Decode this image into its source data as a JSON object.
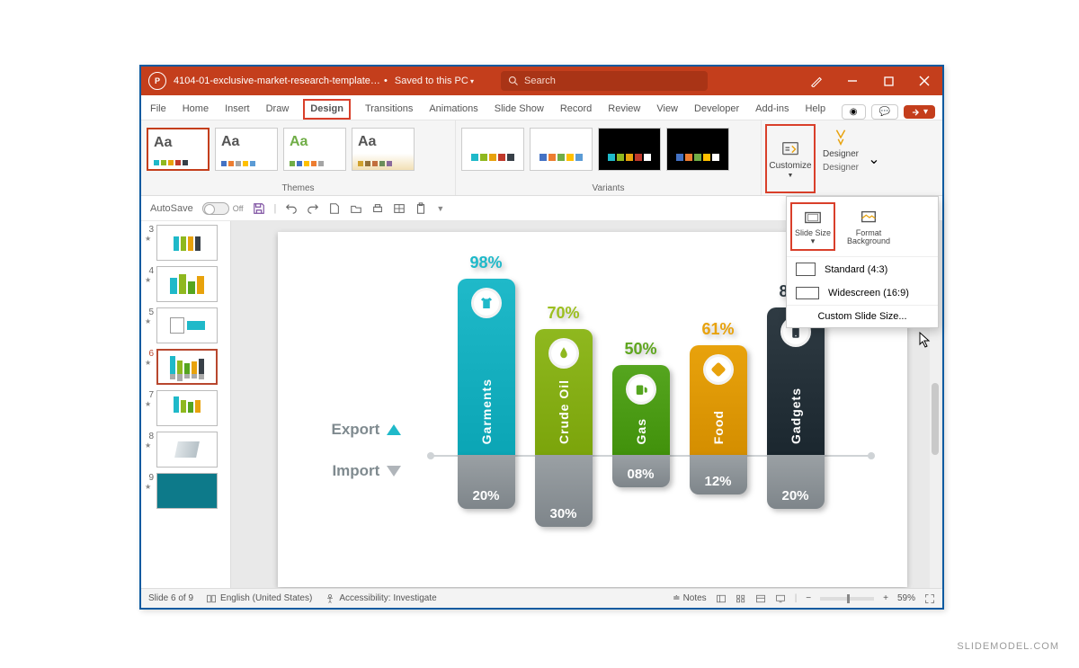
{
  "titlebar": {
    "filename": "4104-01-exclusive-market-research-template....",
    "save_status": "Saved to this PC",
    "search_placeholder": "Search"
  },
  "tabs": {
    "items": [
      "File",
      "Home",
      "Insert",
      "Draw",
      "Design",
      "Transitions",
      "Animations",
      "Slide Show",
      "Record",
      "Review",
      "View",
      "Developer",
      "Add-ins",
      "Help"
    ],
    "active": "Design"
  },
  "ribbon": {
    "themes_label": "Themes",
    "variants_label": "Variants",
    "customize_label": "Customize",
    "designer_label": "Designer",
    "designer_group": "Designer",
    "slide_size_label": "Slide Size",
    "format_bg_label": "Format Background"
  },
  "size_menu": {
    "standard": "Standard (4:3)",
    "widescreen": "Widescreen (16:9)",
    "custom": "Custom Slide Size..."
  },
  "qat": {
    "autosave": "AutoSave",
    "autosave_state": "Off"
  },
  "thumbs": {
    "visible": [
      3,
      4,
      5,
      6,
      7,
      8,
      9
    ],
    "selected": 6
  },
  "chart_data": {
    "type": "bar",
    "title": "",
    "axis_up_label": "Export",
    "axis_down_label": "Import",
    "categories": [
      "Garments",
      "Crude Oil",
      "Gas",
      "Food",
      "Gadgets"
    ],
    "series": [
      {
        "name": "Export",
        "values": [
          98,
          70,
          50,
          61,
          82
        ]
      },
      {
        "name": "Import",
        "values": [
          20,
          30,
          8,
          12,
          20
        ]
      }
    ],
    "import_display": [
      "20%",
      "30%",
      "08%",
      "12%",
      "20%"
    ],
    "colors_top": [
      "#1fb9c9",
      "#8fb81f",
      "#55a51f",
      "#e8a20c",
      "#2f3b43"
    ],
    "pct_colors": [
      "#1fb9c9",
      "#9cbf1f",
      "#5fa61f",
      "#e8a20c",
      "#2f3b43"
    ]
  },
  "status": {
    "slide_pos": "Slide 6 of 9",
    "language": "English (United States)",
    "accessibility": "Accessibility: Investigate",
    "notes": "Notes",
    "zoom": "59%"
  },
  "watermark": "SLIDEMODEL.COM"
}
